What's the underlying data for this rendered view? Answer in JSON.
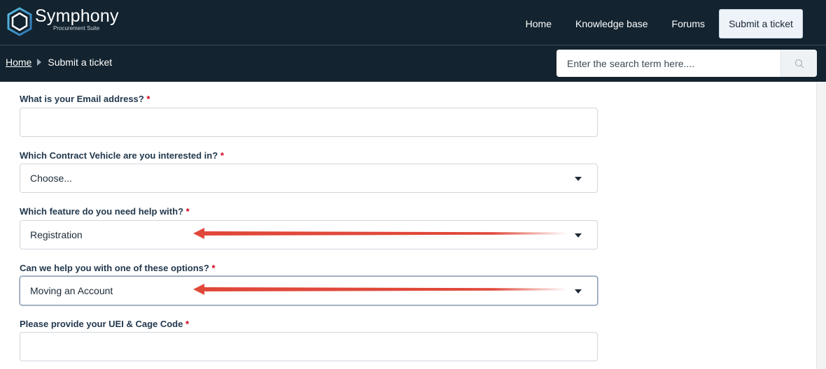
{
  "brand": {
    "name": "Symphony",
    "tagline": "Procurement Suite"
  },
  "nav": {
    "links": [
      "Home",
      "Knowledge base",
      "Forums"
    ],
    "cta_label": "Submit a ticket"
  },
  "breadcrumb": {
    "home": "Home",
    "current": "Submit a ticket"
  },
  "search": {
    "placeholder": "Enter the search term here...."
  },
  "form": {
    "required_mark": "*",
    "email": {
      "label": "What is your Email address?",
      "value": ""
    },
    "contract_vehicle": {
      "label": "Which Contract Vehicle are you interested in?",
      "value": "Choose..."
    },
    "feature": {
      "label": "Which feature do you need help with?",
      "value": "Registration"
    },
    "options": {
      "label": "Can we help you with one of these options?",
      "value": "Moving an Account"
    },
    "uei": {
      "label": "Please provide your UEI & Cage Code",
      "value": ""
    }
  },
  "colors": {
    "header_bg": "#13232f",
    "label": "#22384d",
    "required": "#d0021b",
    "arrow": "#e0483a"
  },
  "icons": {
    "logo": "hexagon-logo-icon",
    "search": "search-icon",
    "dropdown": "chevron-down-icon",
    "annotation": "red-arrow-icon"
  }
}
